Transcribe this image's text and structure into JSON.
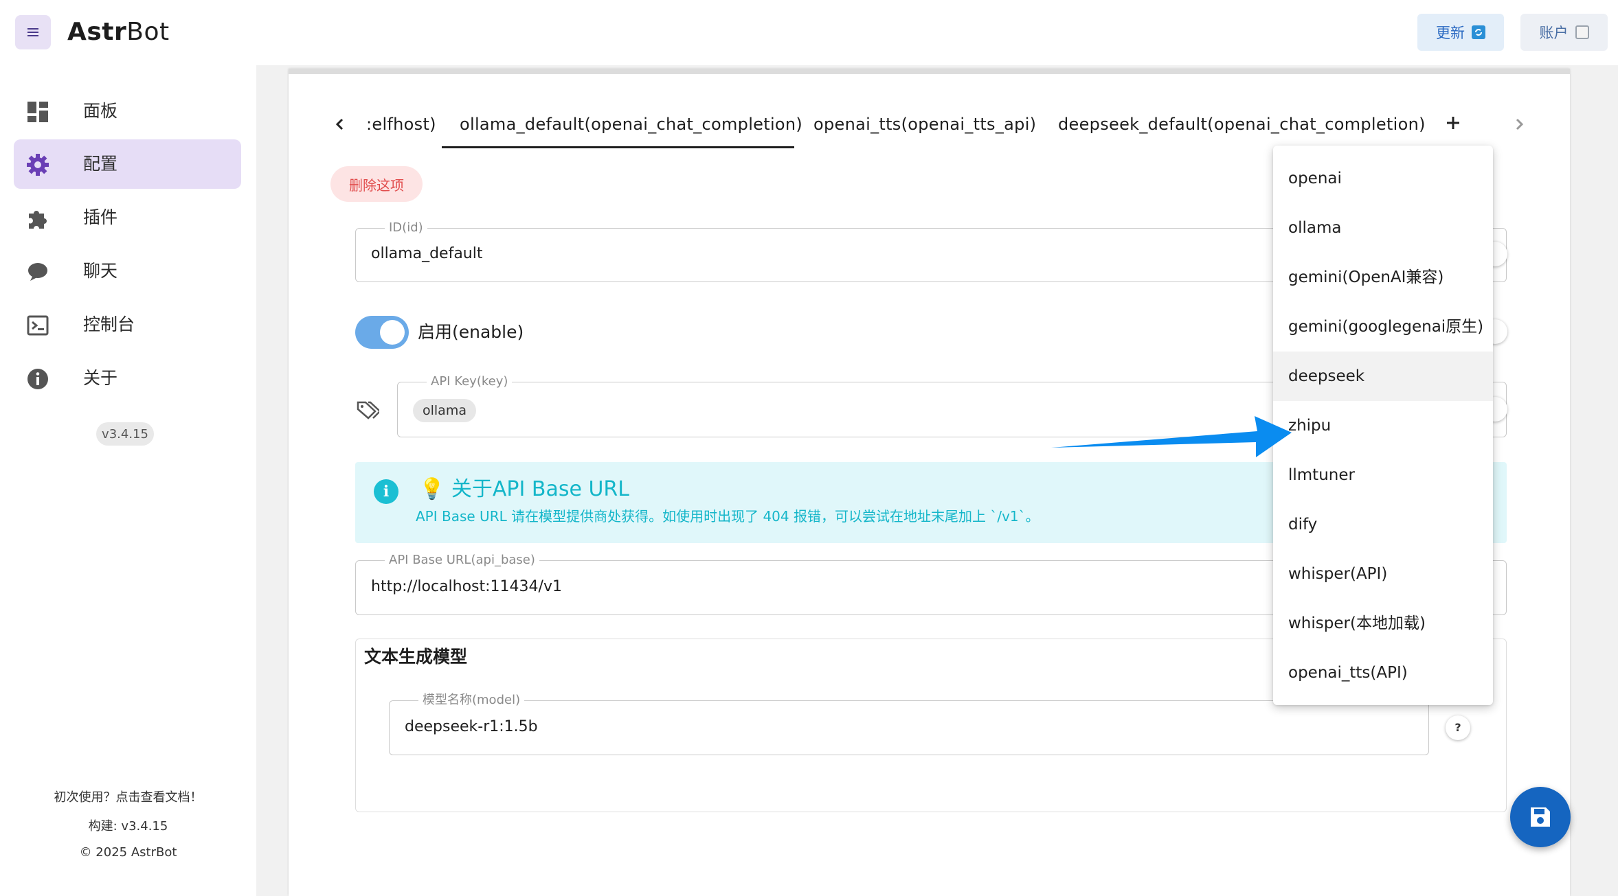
{
  "header": {
    "brand_bold": "Astr",
    "brand_rest": "Bot",
    "update_label": "更新",
    "account_label": "账户"
  },
  "sidebar": {
    "items": [
      {
        "label": "面板",
        "icon": "dashboard-icon"
      },
      {
        "label": "配置",
        "icon": "gear-icon",
        "active": true
      },
      {
        "label": "插件",
        "icon": "puzzle-icon"
      },
      {
        "label": "聊天",
        "icon": "chat-bubble-icon"
      },
      {
        "label": "控制台",
        "icon": "terminal-icon"
      },
      {
        "label": "关于",
        "icon": "info-icon"
      }
    ],
    "version": "v3.4.15",
    "first_use": "初次使用？点击查看文档！",
    "build": "构建: v3.4.15",
    "copyright": "© 2025 AstrBot"
  },
  "tabs": [
    {
      "label": ":elfhost)"
    },
    {
      "label": "ollama_default(openai_chat_completion)",
      "active": true
    },
    {
      "label": "openai_tts(openai_tts_api)"
    },
    {
      "label": "deepseek_default(openai_chat_completion)"
    }
  ],
  "form": {
    "delete_label": "删除这项",
    "id_legend": "ID(id)",
    "id_value": "ollama_default",
    "enable_label": "启用(enable)",
    "enable_on": true,
    "apikey_legend": "API Key(key)",
    "apikey_chip": "ollama",
    "info_title": "💡 关于API Base URL",
    "info_text": "API Base URL 请在模型提供商处获得。如使用时出现了 404 报错，可以尝试在地址末尾加上 `/v1`。",
    "apibase_legend": "API Base URL(api_base)",
    "apibase_value": "http://localhost:11434/v1",
    "section_title": "文本生成模型",
    "model_legend": "模型名称(model)",
    "model_value": "deepseek-r1:1.5b",
    "help_label": "?"
  },
  "dropdown": {
    "items": [
      "openai",
      "ollama",
      "gemini(OpenAI兼容)",
      "gemini(googlegenai原生)",
      "deepseek",
      "zhipu",
      "llmtuner",
      "dify",
      "whisper(API)",
      "whisper(本地加载)",
      "openai_tts(API)"
    ],
    "hovered": "deepseek"
  },
  "colors": {
    "accent_purple": "#6a3fb5",
    "info_cyan": "#14b6c9",
    "fab_blue": "#1565c0",
    "arrow_blue": "#0a8cf0"
  }
}
